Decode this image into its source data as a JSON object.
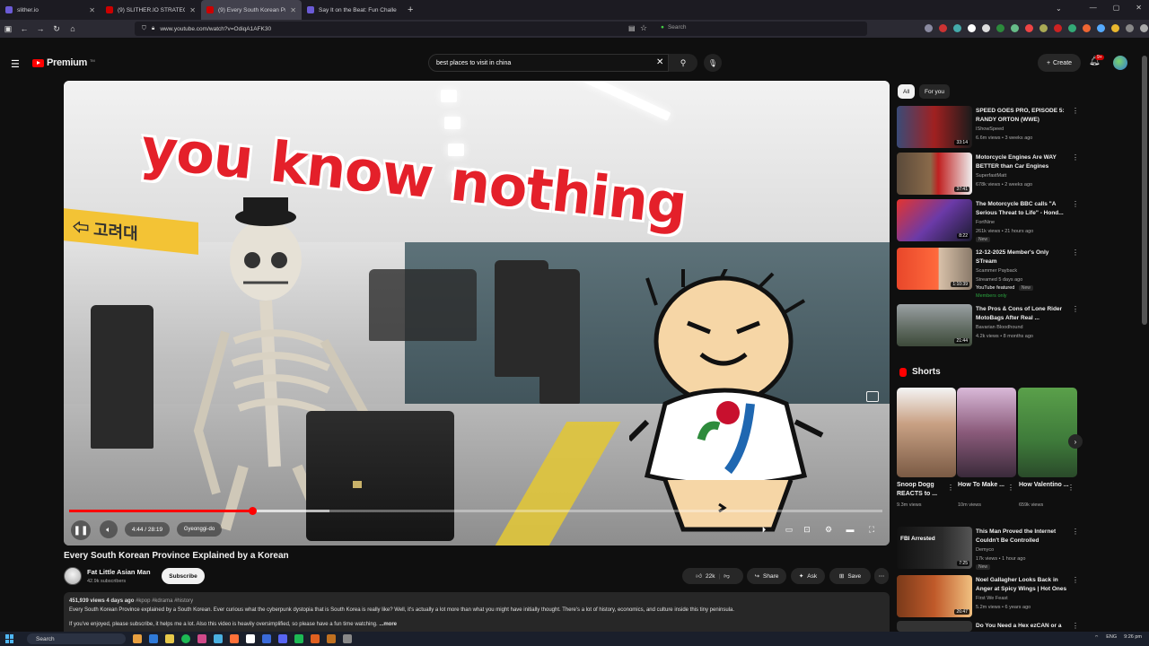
{
  "browser": {
    "tabs": [
      {
        "title": "slither.io",
        "active": false
      },
      {
        "title": "(9) SLITHER.IO STRATEGIES, TIPS",
        "active": false
      },
      {
        "title": "(9) Every South Korean Pro",
        "active": true
      },
      {
        "title": "Say It on the Beat: Fun Challen",
        "active": false
      }
    ],
    "url": "www.youtube.com/watch?v=OdiqA1AFK30",
    "side_search_placeholder": "Search"
  },
  "masthead": {
    "logo_text": "Premium",
    "logo_sup": "TM",
    "search_value": "best places to visit in china",
    "create_label": "Create",
    "notification_count": "9+"
  },
  "player": {
    "overlay_text": "you know nothing",
    "time_text": "4:44 / 28:19",
    "chapter_text": "Gyeonggi-do",
    "progress_fraction": 0.225,
    "buffer_fraction": 0.32
  },
  "video": {
    "title": "Every South Korean Province Explained by a Korean",
    "channel_name": "Fat Little Asian Man",
    "subscribers": "42.9k subscribers",
    "subscribe_label": "Subscribe",
    "likes": "22k",
    "share_label": "Share",
    "ask_label": "Ask",
    "save_label": "Save",
    "views_date": "451,939 views  4 days ago",
    "hashtags": "#kpop #kdrama #history",
    "description_line1": "Every South Korean Province explained by a South Korean. Ever curious what the cyberpunk dystopia that is South Korea is really like? Well, it's actually a lot more than what you might have initially thought. There's a lot of history, economics, and culture inside this tiny peninsula.",
    "description_line2": "If you've enjoyed, please subscribe, it helps me a lot. Also this video is heavily oversimplified, so please have a fun time watching.",
    "more_label": "...more"
  },
  "sidebar": {
    "chips": [
      "All",
      "For you"
    ],
    "recommendations": [
      {
        "title": "SPEED GOES PRO, EPISODE 5: RANDY ORTON (WWE)",
        "channel": "IShowSpeed",
        "meta": "6.6m views • 3 weeks ago",
        "duration": "33:14",
        "thumb": "speed"
      },
      {
        "title": "Motorcycle Engines Are WAY BETTER than Car Engines",
        "channel": "SuperfastMatt",
        "meta": "678k views • 2 weeks ago",
        "duration": "37:41",
        "thumb": "engine"
      },
      {
        "title": "The Motorcycle BBC calls \"A Serious Threat to Life\" - Hond...",
        "channel": "FortNine",
        "meta": "261k views • 21 hours ago",
        "duration": "8:22",
        "badge": "New",
        "thumb": "bbc"
      },
      {
        "title": "12-12-2025 Member's Only STream",
        "channel": "Scammer Payback",
        "meta": "Streamed 5 days ago",
        "extra": "YouTube featured",
        "extra2": "New",
        "members": "Members only",
        "duration": "1:10:39",
        "thumb": "scam"
      },
      {
        "title": "The Pros & Cons of Lone Rider MotoBags After Real ...",
        "channel": "Bavarian Bloodhound",
        "meta": "4.2k views • 8 months ago",
        "duration": "21:44",
        "thumb": "moto"
      }
    ],
    "shorts_label": "Shorts",
    "shorts": [
      {
        "title": "Snoop Dogg REACTS to ...",
        "views": "9.3m views"
      },
      {
        "title": "How To Make ...",
        "views": "10m views"
      },
      {
        "title": "How Valentino ...",
        "views": "659k views"
      }
    ],
    "more_recs": [
      {
        "title": "This Man Proved the Internet Couldn't Be Controlled",
        "channel": "Demyco",
        "meta": "17k views • 1 hour ago",
        "duration": "7:25",
        "badge": "New",
        "thumb_text": "FBI Arrested"
      },
      {
        "title": "Noel Gallagher Looks Back in Anger at Spicy Wings | Hot Ones",
        "channel": "First We Feast",
        "meta": "5.2m views • 6 years ago",
        "duration": "26:47"
      },
      {
        "title": "Do You Need a Hex ezCAN or a"
      }
    ]
  },
  "taskbar": {
    "search_placeholder": "Search",
    "lang": "ENG",
    "clock": "9:26 pm"
  }
}
